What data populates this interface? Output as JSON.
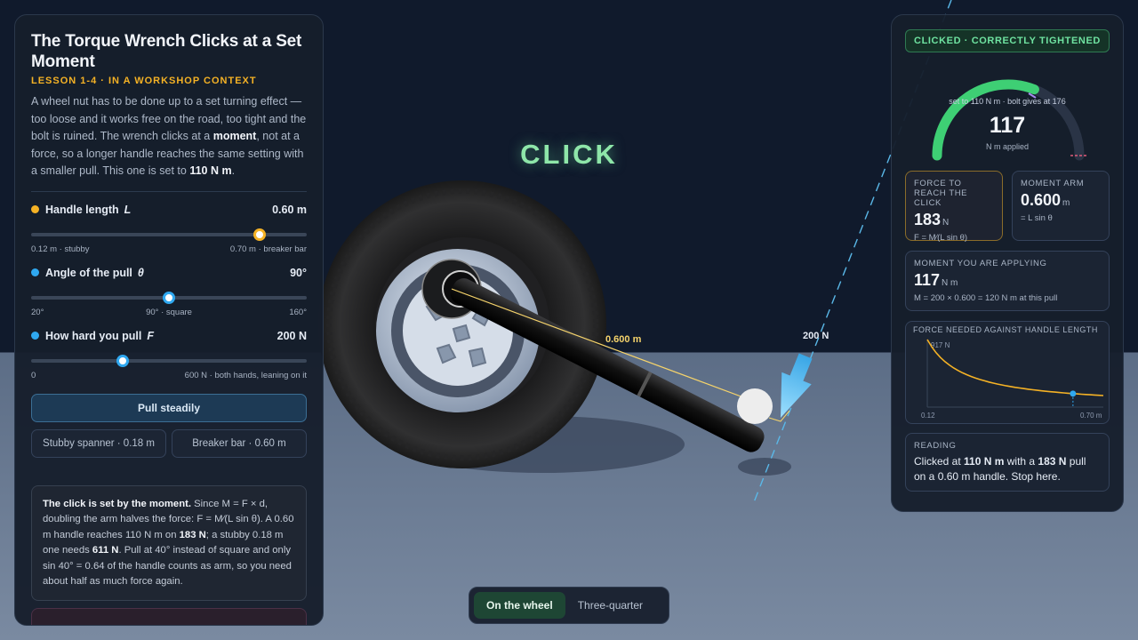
{
  "panel": {
    "title": "The Torque Wrench Clicks at a Set Moment",
    "lesson": "LESSON 1-4 · IN A WORKSHOP CONTEXT",
    "intro": {
      "p1": "A wheel nut has to be done up to a set turning effect — too loose and it works free on the road, too tight and the bolt is ruined. The wrench clicks at a ",
      "b1": "moment",
      "p2": ", not at a force, so a longer handle reaches the same setting with a smaller pull. This one is set to ",
      "b2": "110 N m",
      "p3": "."
    }
  },
  "controls": {
    "length": {
      "label": "Handle length",
      "symbol": "L",
      "value": "0.60 m",
      "min_label": "0.12 m · stubby",
      "max_label": "0.70 m · breaker bar",
      "fraction": 0.83,
      "color": "#f5b225"
    },
    "angle": {
      "label": "Angle of the pull",
      "symbol": "θ",
      "value": "90°",
      "ticks": [
        "20°",
        "90° · square",
        "160°"
      ],
      "fraction": 0.5,
      "color": "#2fa8f0"
    },
    "force": {
      "label": "How hard you pull",
      "symbol": "F",
      "value": "200 N",
      "min_label": "0",
      "max_label": "600 N · both hands, leaning on it",
      "fraction": 0.3333,
      "color": "#2fa8f0"
    }
  },
  "buttons": {
    "pull": "Pull steadily",
    "stubby": "Stubby spanner · 0.18 m",
    "breaker": "Breaker bar · 0.60 m"
  },
  "explain": {
    "b1": "The click is set by the moment.",
    "t1": " Since M = F × d, doubling the arm halves the force: F = M⁄(L sin θ). A 0.60 m handle reaches 110 N m on ",
    "b2": "183 N",
    "t2": "; a stubby 0.18 m one needs ",
    "b3": "611 N",
    "t3": ". Pull at 40° instead of square and only sin 40° = 0.64 of the handle counts as arm, so you need about half as much force again."
  },
  "scene": {
    "click_text": "CLICK",
    "arm_label": "0.600 m",
    "force_label": "200 N"
  },
  "view": {
    "options": [
      "On the wheel",
      "Three-quarter"
    ],
    "active": "On the wheel"
  },
  "readout": {
    "status": "CLICKED · CORRECTLY TIGHTENED",
    "gauge_caption": "set to 110 N m · bolt gives at 176",
    "gauge_value": "117",
    "gauge_unit": "N m applied",
    "gauge_fraction": 0.62,
    "force_card": {
      "label": "FORCE TO REACH THE CLICK",
      "value": "183",
      "unit": "N",
      "formula": "F = M⁄(L sin θ)"
    },
    "arm_card": {
      "label": "MOMENT ARM",
      "value": "0.600",
      "unit": "m",
      "formula": "= L sin θ"
    },
    "moment_card": {
      "label": "MOMENT YOU ARE APPLYING",
      "value": "117",
      "unit": "N m",
      "formula": "M = 200 × 0.600 = 120 N m at this pull"
    },
    "chart": {
      "title": "FORCE NEEDED AGAINST HANDLE LENGTH",
      "y_max_label": "917 N",
      "x_min_label": "0.12",
      "x_max_label": "0.70 m"
    },
    "reading": {
      "label": "READING",
      "t1": "Clicked at ",
      "b1": "110 N m",
      "t2": " with a ",
      "b2": "183 N",
      "t3": " pull on a 0.60 m handle. Stop here."
    }
  },
  "chart_data": {
    "type": "line",
    "title": "FORCE NEEDED AGAINST HANDLE LENGTH",
    "xlim": [
      0.12,
      0.7
    ],
    "ylim": [
      0,
      917
    ],
    "series": [
      {
        "x": [
          0.12,
          0.18,
          0.25,
          0.3,
          0.4,
          0.5,
          0.6,
          0.7
        ],
        "y": [
          917,
          611,
          440,
          367,
          275,
          220,
          183,
          157
        ]
      }
    ],
    "marker": {
      "x": 0.6,
      "y": 183
    },
    "colors": {
      "line": "#f5b225",
      "marker": "#2fa8f0"
    }
  }
}
